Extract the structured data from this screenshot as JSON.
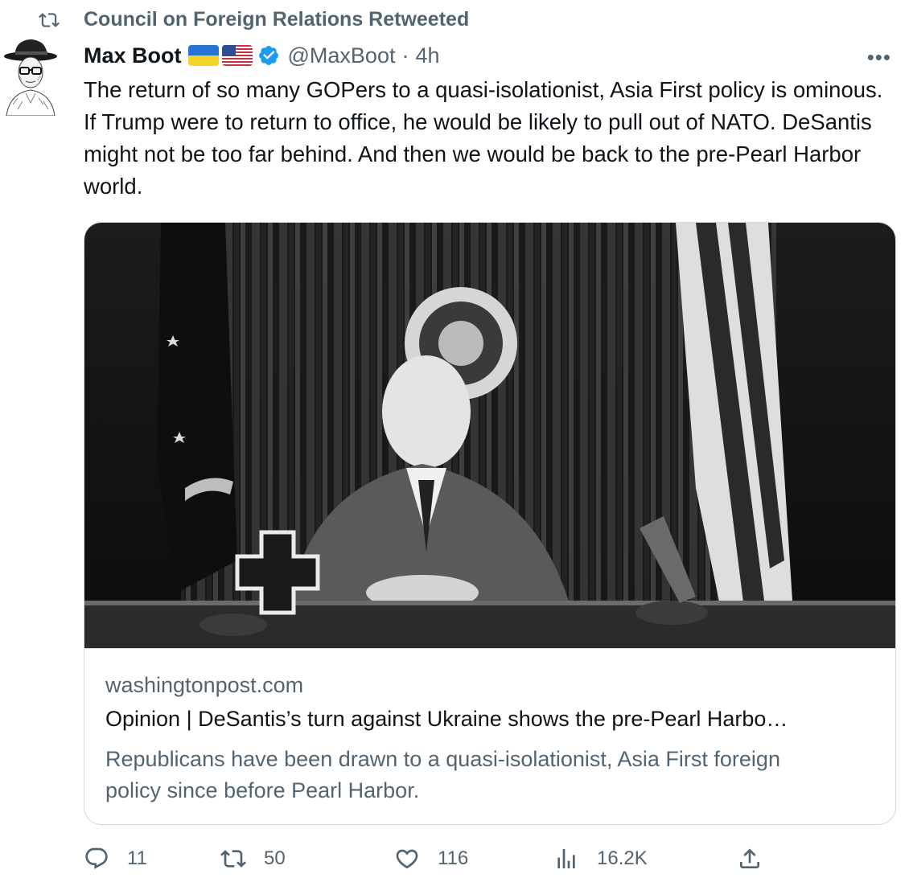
{
  "social_context": {
    "text": "Council on Foreign Relations Retweeted",
    "icon": "retweet-icon"
  },
  "author": {
    "name": "Max Boot",
    "flags": [
      "ukraine-flag",
      "us-flag"
    ],
    "verified": true,
    "handle": "@MaxBoot",
    "separator": "·",
    "time": "4h"
  },
  "more_label": "•••",
  "tweet_text": "The return of so many GOPers to a quasi-isolationist, Asia First policy is ominous. If Trump were to return to office, he would be likely to pull out of NATO. DeSantis might not be too far behind. And then we would be back to the pre-Pearl Harbor world.",
  "card": {
    "image": "black-and-white-photo-man-at-desk-with-flags-and-presidential-seal",
    "domain": "washingtonpost.com",
    "title": "Opinion | DeSantis’s turn against Ukraine shows the pre-Pearl Harbo…",
    "description": "Republicans have been drawn to a quasi-isolationist, Asia First foreign policy since before Pearl Harbor."
  },
  "actions": {
    "reply": {
      "icon": "reply-icon",
      "count": "11"
    },
    "retweet": {
      "icon": "retweet-icon",
      "count": "50"
    },
    "like": {
      "icon": "heart-icon",
      "count": "116"
    },
    "views": {
      "icon": "views-icon",
      "count": "16.2K"
    },
    "share": {
      "icon": "share-icon"
    }
  },
  "colors": {
    "text_primary": "#0f1419",
    "text_secondary": "#536471",
    "border": "#cfd9de",
    "verified_blue": "#1d9bf0"
  }
}
